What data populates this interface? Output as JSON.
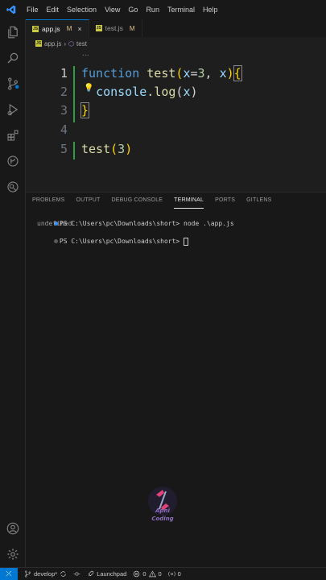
{
  "menu": [
    "File",
    "Edit",
    "Selection",
    "View",
    "Go",
    "Run",
    "Terminal",
    "Help"
  ],
  "tabs": [
    {
      "name": "app.js",
      "modified": "M",
      "close": "×"
    },
    {
      "name": "test.js",
      "modified": "M"
    }
  ],
  "breadcrumb": {
    "file": "app.js",
    "sep": "›",
    "symbol": "test"
  },
  "overflow_dots": "...",
  "editor": {
    "line_numbers": [
      "1",
      "2",
      "3",
      "4",
      "5"
    ]
  },
  "panel": {
    "tabs": [
      "PROBLEMS",
      "OUTPUT",
      "DEBUG CONSOLE",
      "TERMINAL",
      "PORTS",
      "GITLENS"
    ],
    "terminal": {
      "line1_prompt": "PS C:\\Users\\pc\\Downloads\\short>",
      "line1_cmd": "node .\\app.js",
      "line2": "undefined",
      "line3_prompt": "PS C:\\Users\\pc\\Downloads\\short>"
    }
  },
  "watermark": {
    "line1": "Apni",
    "line2": "Coding"
  },
  "statusbar": {
    "branch": "develop*",
    "launchpad": "Launchpad",
    "errors": "0",
    "warnings": "0",
    "ports": "0"
  },
  "colors": {
    "accent": "#0078d4",
    "js_badge": "#cbcb41",
    "modified": "#e2c08d"
  }
}
